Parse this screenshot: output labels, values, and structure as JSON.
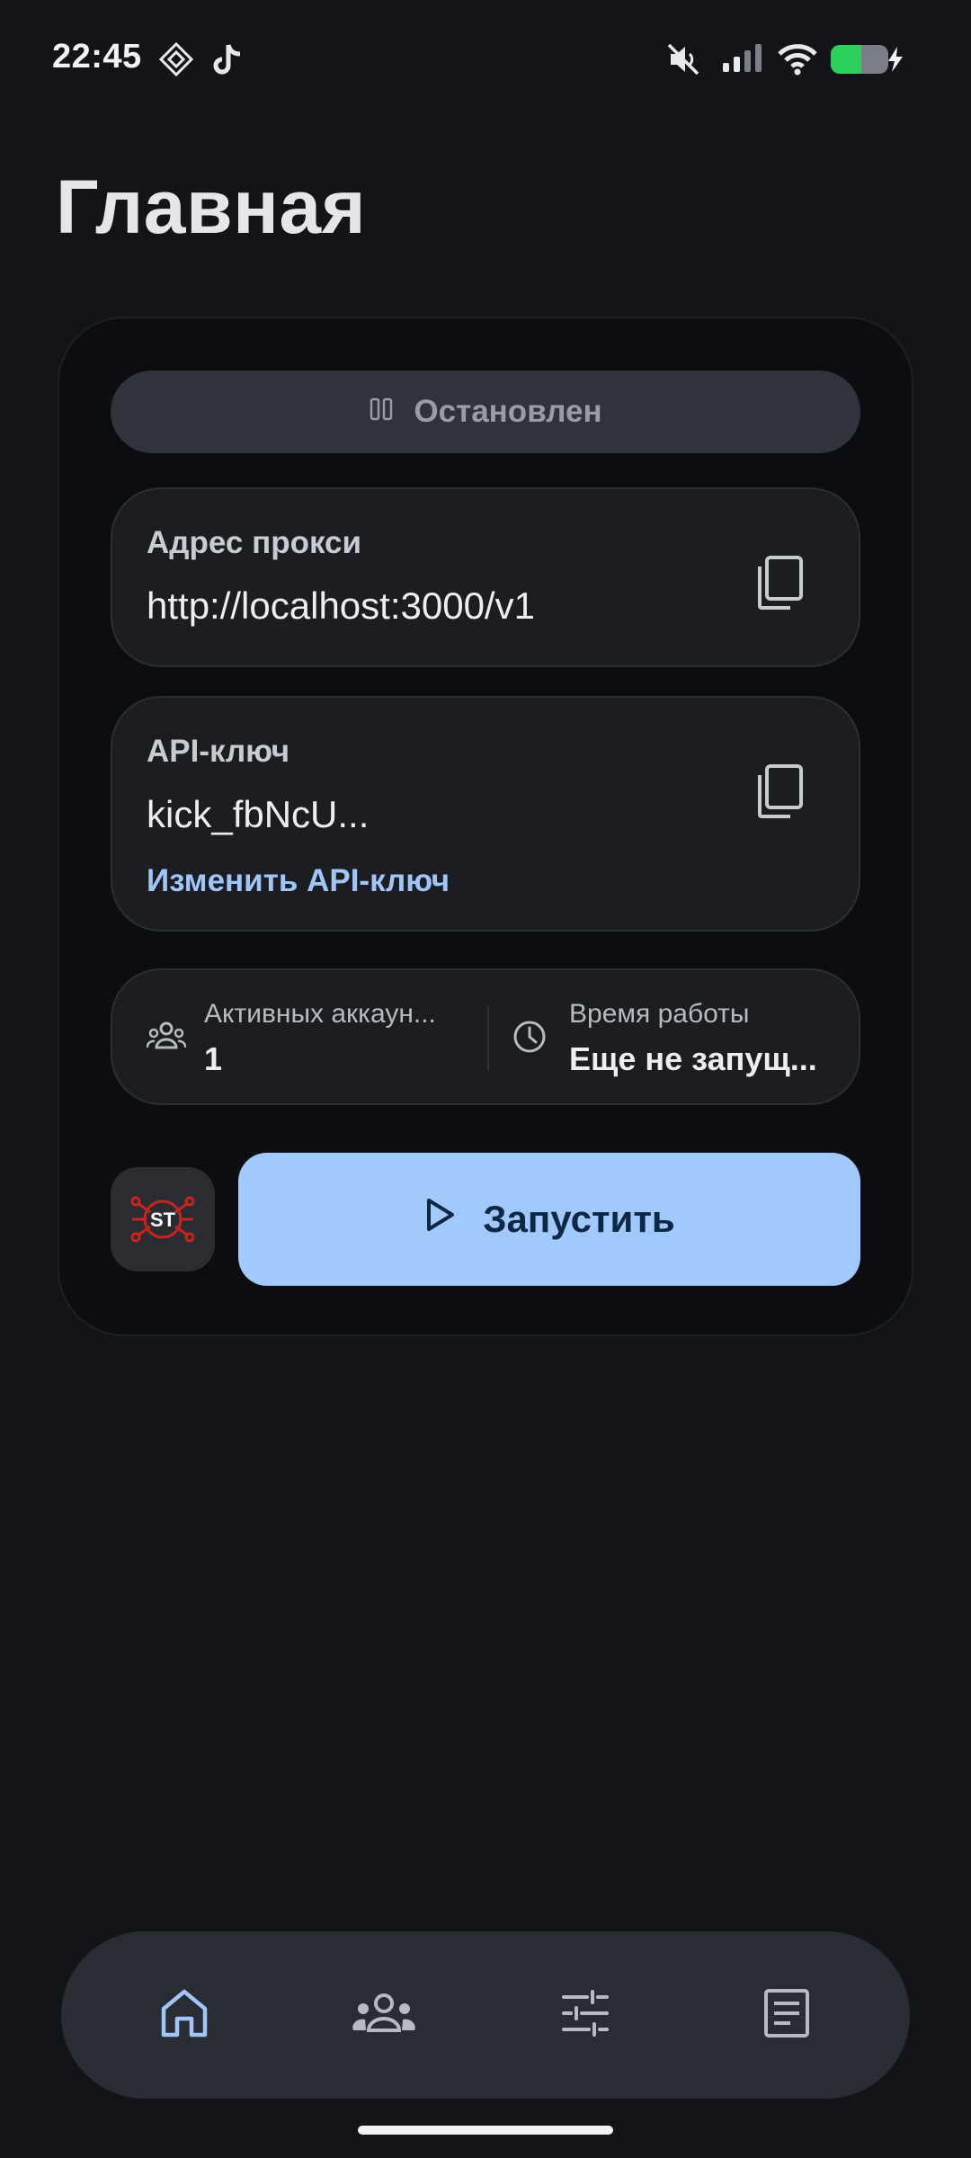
{
  "status_bar": {
    "time": "22:45",
    "icons": [
      "app-diamond-icon",
      "tiktok-icon",
      "mute-icon",
      "signal-icon",
      "wifi-icon",
      "battery-charging-icon"
    ],
    "battery_color": "#2bd15b"
  },
  "page": {
    "title": "Главная"
  },
  "server_status": {
    "label": "Остановлен",
    "icon": "pause-icon"
  },
  "proxy": {
    "label": "Адрес прокси",
    "value": "http://localhost:3000/v1",
    "copy_icon": "copy-icon"
  },
  "api_key": {
    "label": "API-ключ",
    "value": "kick_fbNcU...",
    "change_link": "Изменить API-ключ",
    "copy_icon": "copy-icon"
  },
  "stats": {
    "accounts": {
      "label": "Активных аккаун...",
      "value": "1",
      "icon": "people-icon"
    },
    "uptime": {
      "label": "Время работы",
      "value": "Еще не запущ...",
      "icon": "clock-icon"
    }
  },
  "actions": {
    "logo_text": "ST",
    "start_label": "Запустить",
    "start_icon": "play-icon"
  },
  "nav": {
    "items": [
      {
        "icon": "home-icon",
        "active": true
      },
      {
        "icon": "people-icon",
        "active": false
      },
      {
        "icon": "sliders-icon",
        "active": false
      },
      {
        "icon": "document-icon",
        "active": false
      }
    ],
    "active_color": "#9fc6f6"
  }
}
